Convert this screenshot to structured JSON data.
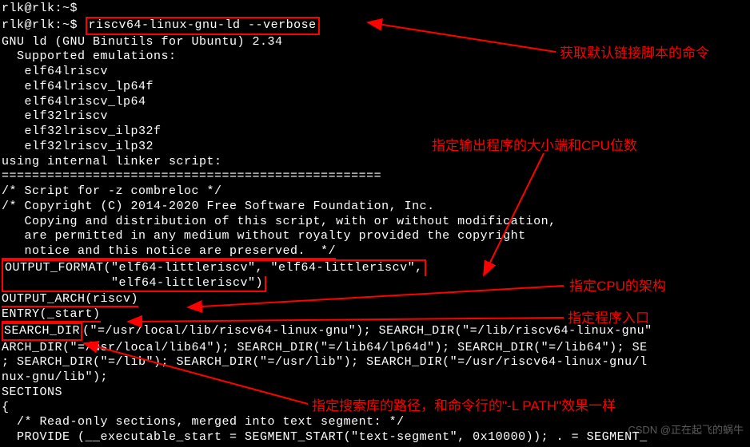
{
  "prompt1": "rlk@rlk:~$ ",
  "prompt2": "rlk@rlk:~$ ",
  "command": "riscv64-linux-gnu-ld --verbose",
  "lines": {
    "gnu_ld": "GNU ld (GNU Binutils for Ubuntu) 2.34",
    "supported": "  Supported emulations:",
    "emu1": "   elf64lriscv",
    "emu2": "   elf64lriscv_lp64f",
    "emu3": "   elf64lriscv_lp64",
    "emu4": "   elf32lriscv",
    "emu5": "   elf32lriscv_ilp32f",
    "emu6": "   elf32lriscv_ilp32",
    "using": "using internal linker script:",
    "sep": "==================================================",
    "script": "/* Script for -z combreloc */",
    "copyright": "/* Copyright (C) 2014-2020 Free Software Foundation, Inc.",
    "copying": "   Copying and distribution of this script, with or without modification,",
    "permitted": "   are permitted in any medium without royalty provided the copyright",
    "notice": "   notice and this notice are preserved.  */",
    "output_format1": "OUTPUT_FORMAT(\"elf64-littleriscv\", \"elf64-littleriscv\",",
    "output_format2": "              \"elf64-littleriscv\")",
    "output_arch": "OUTPUT_ARCH(riscv)",
    "entry": "ENTRY(_start)",
    "search_dir_pre": "SEARCH_DIR",
    "search_dir_rest": "(\"=/usr/local/lib/riscv64-linux-gnu\"); SEARCH_DIR(\"=/lib/riscv64-linux-gnu\"",
    "arch_dir": "ARCH_DIR(\"=/usr/local/lib64\"); SEARCH_DIR(\"=/lib64/lp64d\"); SEARCH_DIR(\"=/lib64\"); SE",
    "search2": "; SEARCH_DIR(\"=/lib\"); SEARCH_DIR(\"=/usr/lib\"); SEARCH_DIR(\"=/usr/riscv64-linux-gnu/l",
    "nux": "nux-gnu/lib\");",
    "sections": "SECTIONS",
    "brace": "{",
    "readonly": "  /* Read-only sections, merged into text segment: */",
    "provide": "  PROVIDE (__executable_start = SEGMENT_START(\"text-segment\", 0x10000)); . = SEGMENT_"
  },
  "annotations": {
    "get_script": "获取默认链接脚本的命令",
    "endian_cpu": "指定输出程序的大小端和CPU位数",
    "cpu_arch": "指定CPU的架构",
    "entry_point": "指定程序入口",
    "search_path": "指定搜索库的路径，和命令行的\"-L PATH\"效果一样"
  },
  "watermark": "CSDN @正在起飞的蜗牛"
}
